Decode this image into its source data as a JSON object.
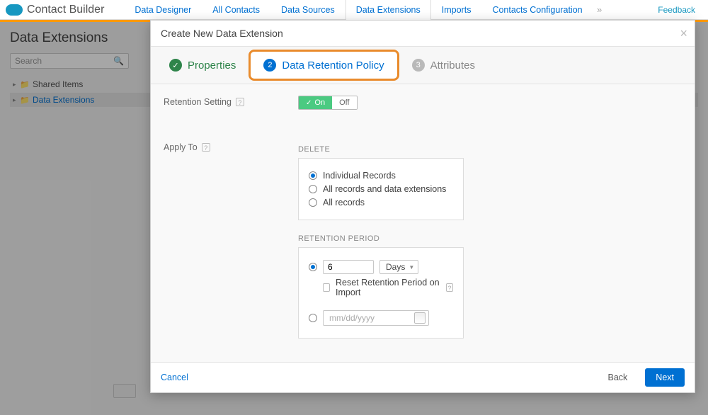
{
  "brand": {
    "title": "Contact Builder"
  },
  "tabs": {
    "items": [
      {
        "label": "Data Designer"
      },
      {
        "label": "All Contacts"
      },
      {
        "label": "Data Sources"
      },
      {
        "label": "Data Extensions"
      },
      {
        "label": "Imports"
      },
      {
        "label": "Contacts Configuration"
      }
    ],
    "active_index": 3,
    "feedback": "Feedback"
  },
  "page": {
    "title": "Data Extensions",
    "search_placeholder": "Search",
    "tree": [
      {
        "label": "Shared Items",
        "selected": false
      },
      {
        "label": "Data Extensions",
        "selected": true
      }
    ]
  },
  "modal": {
    "title": "Create New Data Extension",
    "steps": [
      {
        "label": "Properties",
        "state": "done",
        "num": "✓"
      },
      {
        "label": "Data Retention Policy",
        "state": "current",
        "num": "2"
      },
      {
        "label": "Attributes",
        "state": "upcoming",
        "num": "3"
      }
    ],
    "retention": {
      "label": "Retention Setting",
      "on": "On",
      "off": "Off"
    },
    "apply": {
      "label": "Apply To",
      "delete_heading": "DELETE",
      "options": [
        "Individual Records",
        "All records and data extensions",
        "All records"
      ],
      "selected_delete": 0,
      "period_heading": "RETENTION PERIOD",
      "period_value": "6",
      "period_unit": "Days",
      "reset_label": "Reset Retention Period on Import",
      "date_placeholder": "mm/dd/yyyy"
    },
    "footer": {
      "cancel": "Cancel",
      "back": "Back",
      "next": "Next"
    }
  }
}
